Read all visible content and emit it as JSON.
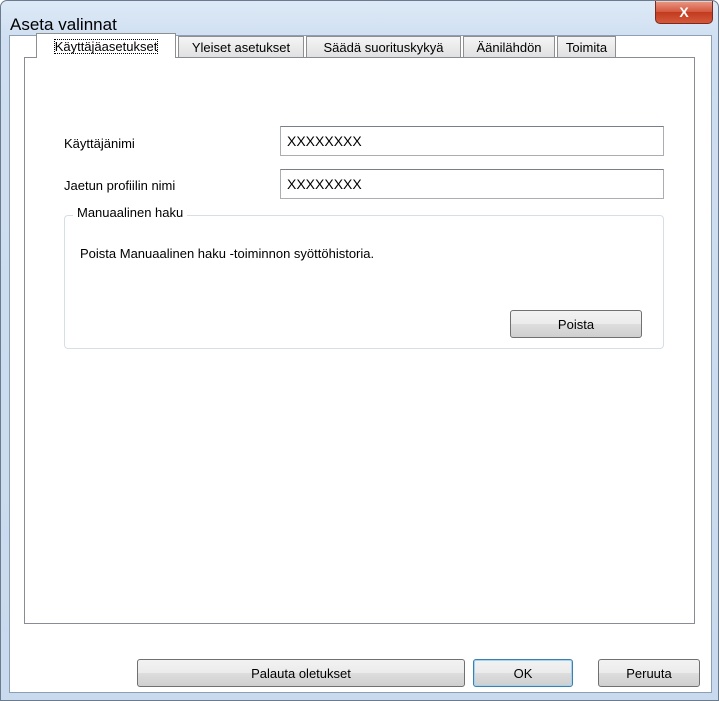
{
  "window": {
    "title": "Aseta valinnat",
    "close_label": "X"
  },
  "tabs": [
    {
      "label": "Käyttäjäasetukset",
      "active": true
    },
    {
      "label": "Yleiset asetukset",
      "active": false
    },
    {
      "label": "Säädä suorituskykyä",
      "active": false
    },
    {
      "label": "Äänilähdön",
      "active": false
    },
    {
      "label": "Toimita",
      "active": false
    }
  ],
  "user_settings": {
    "username_label": "Käyttäjänimi",
    "username_value": "XXXXXXXX",
    "shared_profile_label": "Jaetun profiilin nimi",
    "shared_profile_value": "XXXXXXXX"
  },
  "manual_search": {
    "group_title": "Manuaalinen haku",
    "description": "Poista Manuaalinen haku -toiminnon syöttöhistoria.",
    "delete_label": "Poista"
  },
  "footer": {
    "restore_label": "Palauta oletukset",
    "ok_label": "OK",
    "cancel_label": "Peruuta"
  }
}
